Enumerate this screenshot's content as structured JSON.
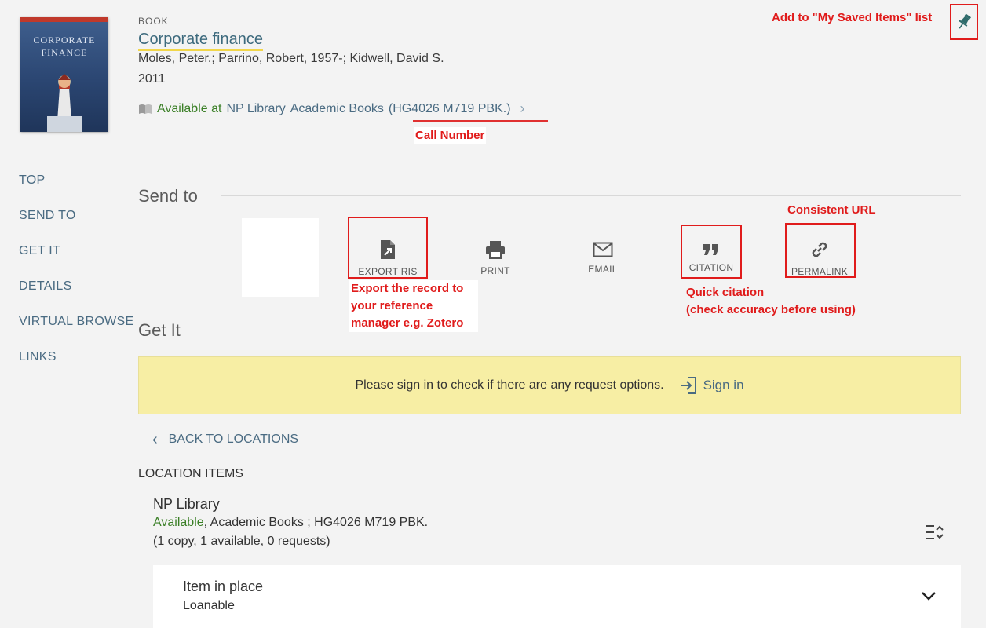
{
  "record": {
    "type": "BOOK",
    "title": "Corporate finance",
    "authors": "Moles, Peter.; Parrino, Robert, 1957-; Kidwell, David S.",
    "year": "2011",
    "availability": {
      "status": "Available at",
      "library": "NP Library",
      "collection": "Academic Books",
      "call_number": "(HG4026 M719 PBK.)"
    },
    "cover": {
      "line1": "CORPORATE",
      "line2": "FINANCE"
    }
  },
  "annotations": {
    "saved_items": "Add to \"My Saved Items\" list",
    "call_number": "Call Number",
    "consistent_url": "Consistent URL",
    "export_ris": [
      "Export the record to",
      "your reference",
      "manager e.g. Zotero"
    ],
    "citation": [
      "Quick citation",
      "(check accuracy before using)"
    ]
  },
  "nav": [
    "TOP",
    "SEND TO",
    "GET IT",
    "DETAILS",
    "VIRTUAL BROWSE",
    "LINKS"
  ],
  "send_to": {
    "heading": "Send to",
    "actions": [
      {
        "label": "EXPORT RIS",
        "icon": "export-file-icon"
      },
      {
        "label": "PRINT",
        "icon": "printer-icon"
      },
      {
        "label": "EMAIL",
        "icon": "envelope-icon"
      },
      {
        "label": "CITATION",
        "icon": "quote-icon"
      },
      {
        "label": "PERMALINK",
        "icon": "link-icon"
      }
    ]
  },
  "get_it": {
    "heading": "Get It",
    "sign_in_message": "Please sign in to check if there are any request options.",
    "sign_in_label": "Sign in",
    "back_label": "BACK TO LOCATIONS",
    "location_items_label": "LOCATION ITEMS",
    "location": {
      "name": "NP Library",
      "status": "Available",
      "detail": ", Academic Books ; HG4026 M719 PBK.",
      "copies": "(1 copy, 1 available, 0 requests)"
    },
    "item": {
      "title": "Item in place",
      "policy": "Loanable"
    }
  },
  "colors": {
    "accent": "#4a6b82",
    "available": "#3a7f26",
    "annotation": "#e01b1b",
    "banner": "#f7eea4"
  }
}
